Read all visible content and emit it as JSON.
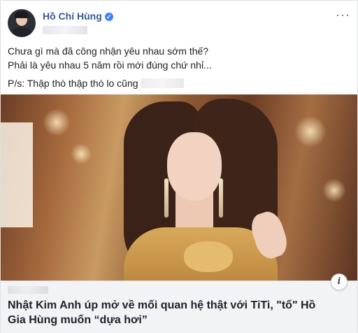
{
  "post": {
    "author": "Hồ Chí Hùng",
    "verified_mark": "✓",
    "more_label": "···",
    "text_line1": "Chưa gì mà đã công nhận yêu nhau sớm thế?",
    "text_line2": "Phải là yêu nhau 5 năm rồi mới đúng chứ nhỉ...",
    "ps_text": "P/s: Thập thò thập thò lo cũng",
    "icons": [
      "verified-icon",
      "more-icon",
      "info-icon"
    ]
  },
  "link": {
    "title": "Nhật Kim Anh úp mở về mối quan hệ thật với TiTi, \"tố\" Hồ Gia Hùng muốn “dựa hơi”",
    "info_label": "i"
  },
  "colors": {
    "author": "#365899",
    "verified": "#4080ff",
    "link_bg": "#f2f3f5"
  }
}
